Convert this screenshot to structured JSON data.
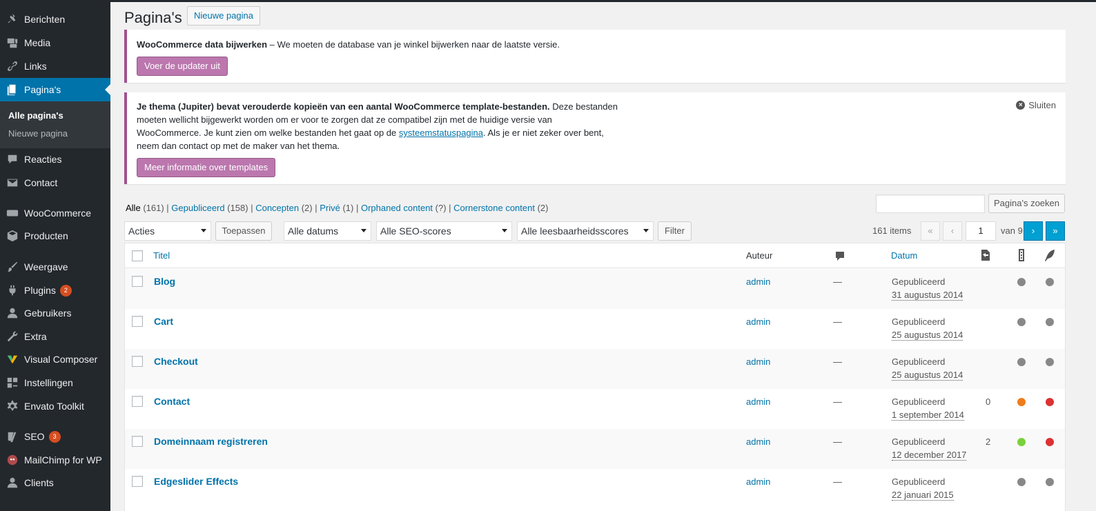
{
  "sidebar": {
    "items": [
      {
        "label": "Berichten",
        "icon": "pin-icon"
      },
      {
        "label": "Media",
        "icon": "media-icon"
      },
      {
        "label": "Links",
        "icon": "link-icon"
      },
      {
        "label": "Pagina's",
        "icon": "pages-icon"
      },
      {
        "label": "Reacties",
        "icon": "comment-icon"
      },
      {
        "label": "Contact",
        "icon": "mail-icon"
      },
      {
        "label": "WooCommerce",
        "icon": "woo-icon"
      },
      {
        "label": "Producten",
        "icon": "box-icon"
      },
      {
        "label": "Weergave",
        "icon": "brush-icon"
      },
      {
        "label": "Plugins",
        "icon": "plugin-icon",
        "badge": "2"
      },
      {
        "label": "Gebruikers",
        "icon": "user-icon"
      },
      {
        "label": "Extra",
        "icon": "wrench-icon"
      },
      {
        "label": "Visual Composer",
        "icon": "vc-icon"
      },
      {
        "label": "Instellingen",
        "icon": "settings-icon"
      },
      {
        "label": "Envato Toolkit",
        "icon": "gear-icon"
      },
      {
        "label": "SEO",
        "icon": "yoast-icon",
        "badge": "3"
      },
      {
        "label": "MailChimp for WP",
        "icon": "mailchimp-icon"
      },
      {
        "label": "Clients",
        "icon": "user-icon"
      }
    ],
    "submenu": [
      "Alle pagina's",
      "Nieuwe pagina"
    ]
  },
  "header": {
    "title": "Pagina's",
    "add_new": "Nieuwe pagina"
  },
  "notice1": {
    "strong": "WooCommerce data bijwerken",
    "text": " – We moeten de database van je winkel bijwerken naar de laatste versie.",
    "button": "Voer de updater uit"
  },
  "notice2": {
    "strong": "Je thema (Jupiter) bevat verouderde kopieën van een aantal WooCommerce template-bestanden.",
    "line1_rest": " Deze bestanden",
    "line2": "moeten wellicht bijgewerkt worden om er voor te zorgen dat ze compatibel zijn met de huidige versie van",
    "line3_a": "WooCommerce. Je kunt zien om welke bestanden het gaat op de ",
    "line3_link": "systeemstatuspagina",
    "line3_b": ". Als je er niet zeker over bent,",
    "line4": "neem dan contact op met de maker van het thema.",
    "button": "Meer informatie over templates",
    "dismiss": "Sluiten"
  },
  "filters": {
    "views": [
      {
        "label": "Alle",
        "count": "(161)"
      },
      {
        "label": "Gepubliceerd",
        "count": "(158)"
      },
      {
        "label": "Concepten",
        "count": "(2)"
      },
      {
        "label": "Privé",
        "count": "(1)"
      },
      {
        "label": "Orphaned content",
        "count": "(?)"
      },
      {
        "label": "Cornerstone content",
        "count": "(2)"
      }
    ],
    "search_button": "Pagina's zoeken",
    "bulk_action": "Acties",
    "apply": "Toepassen",
    "dates": "Alle datums",
    "seo": "Alle SEO-scores",
    "readability": "Alle leesbaarheidsscores",
    "filter": "Filter"
  },
  "pagination": {
    "items": "161 items",
    "first": "«",
    "prev": "‹",
    "current": "1",
    "of": "van 9",
    "next": "›",
    "last": "»"
  },
  "table": {
    "headers": {
      "title": "Titel",
      "author": "Auteur",
      "comments_icon": "comment-icon",
      "date": "Datum",
      "links_icon": "link-count-icon",
      "seo_icon": "seo-score-icon",
      "readability_icon": "readability-icon"
    },
    "rows": [
      {
        "title": "Blog",
        "author": "admin",
        "comments": "—",
        "status": "Gepubliceerd",
        "date": "31 augustus 2014",
        "links": "",
        "seo": "#888888",
        "readability": "#888888"
      },
      {
        "title": "Cart",
        "author": "admin",
        "comments": "—",
        "status": "Gepubliceerd",
        "date": "25 augustus 2014",
        "links": "",
        "seo": "#888888",
        "readability": "#888888"
      },
      {
        "title": "Checkout",
        "author": "admin",
        "comments": "—",
        "status": "Gepubliceerd",
        "date": "25 augustus 2014",
        "links": "",
        "seo": "#888888",
        "readability": "#888888"
      },
      {
        "title": "Contact",
        "author": "admin",
        "comments": "—",
        "status": "Gepubliceerd",
        "date": "1 september 2014",
        "links": "0",
        "seo": "#ee7c1b",
        "readability": "#dc3232"
      },
      {
        "title": "Domeinnaam registreren",
        "author": "admin",
        "comments": "—",
        "status": "Gepubliceerd",
        "date": "12 december 2017",
        "links": "2",
        "seo": "#7ad03a",
        "readability": "#dc3232"
      },
      {
        "title": "Edgeslider Effects",
        "author": "admin",
        "comments": "—",
        "status": "Gepubliceerd",
        "date": "22 januari 2015",
        "links": "",
        "seo": "#888888",
        "readability": "#888888"
      }
    ]
  },
  "colors": {
    "sidebar_bg": "#23282d",
    "accent": "#0073aa",
    "woo_purple": "#bb77ae"
  }
}
